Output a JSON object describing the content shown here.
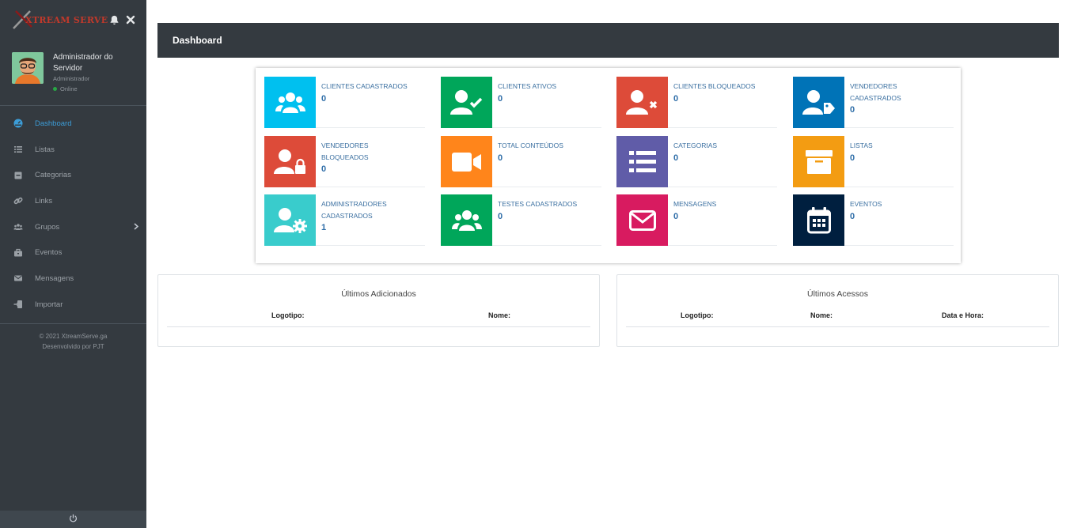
{
  "brand": {
    "logo_text": "XTREAM SERVE"
  },
  "user": {
    "name": "Administrador do Servidor",
    "role": "Administrador",
    "status": "Online"
  },
  "nav": {
    "items": [
      {
        "label": "Dashboard",
        "icon": "dashboard-icon"
      },
      {
        "label": "Listas",
        "icon": "list-icon"
      },
      {
        "label": "Categorias",
        "icon": "folder-icon"
      },
      {
        "label": "Links",
        "icon": "link-icon"
      },
      {
        "label": "Grupos",
        "icon": "users-icon"
      },
      {
        "label": "Eventos",
        "icon": "briefcase-icon"
      },
      {
        "label": "Mensagens",
        "icon": "envelope-icon"
      },
      {
        "label": "Importar",
        "icon": "import-icon"
      }
    ]
  },
  "footer": {
    "line1": "© 2021 XtreamServe.ga",
    "line2": "Desenvolvido por PJT"
  },
  "header": {
    "title": "Dashboard"
  },
  "stats": [
    {
      "label": "Clientes Cadastrados",
      "value": "0",
      "color": "#00c0ef",
      "icon": "users-icon"
    },
    {
      "label": "Clientes Ativos",
      "value": "0",
      "color": "#00a65a",
      "icon": "user-check-icon"
    },
    {
      "label": "Clientes Bloqueados",
      "value": "0",
      "color": "#dd4b39",
      "icon": "user-times-icon"
    },
    {
      "label": "Vendedores Cadastrados",
      "value": "0",
      "color": "#0073b7",
      "icon": "user-tag-icon"
    },
    {
      "label": "Vendedores Bloqueados",
      "value": "0",
      "color": "#dd4b39",
      "icon": "user-lock-icon"
    },
    {
      "label": "Total Conteúdos",
      "value": "0",
      "color": "#ff851b",
      "icon": "video-icon"
    },
    {
      "label": "Categorias",
      "value": "0",
      "color": "#605ca8",
      "icon": "list-icon"
    },
    {
      "label": "Listas",
      "value": "0",
      "color": "#f39c12",
      "icon": "archive-icon"
    },
    {
      "label": "Administradores Cadastrados",
      "value": "1",
      "color": "#39cccc",
      "icon": "user-cog-icon"
    },
    {
      "label": "Testes Cadastrados",
      "value": "0",
      "color": "#00a65a",
      "icon": "users-icon"
    },
    {
      "label": "Mensagens",
      "value": "0",
      "color": "#d81b60",
      "icon": "envelope-icon"
    },
    {
      "label": "Eventos",
      "value": "0",
      "color": "#001f3f",
      "icon": "calendar-icon"
    }
  ],
  "panels": {
    "added": {
      "title": "Últimos Adicionados",
      "col1": "Logotipo:",
      "col2": "Nome:"
    },
    "access": {
      "title": "Últimos Acessos",
      "col1": "Logotipo:",
      "col2": "Nome:",
      "col3": "Data e Hora:"
    }
  }
}
